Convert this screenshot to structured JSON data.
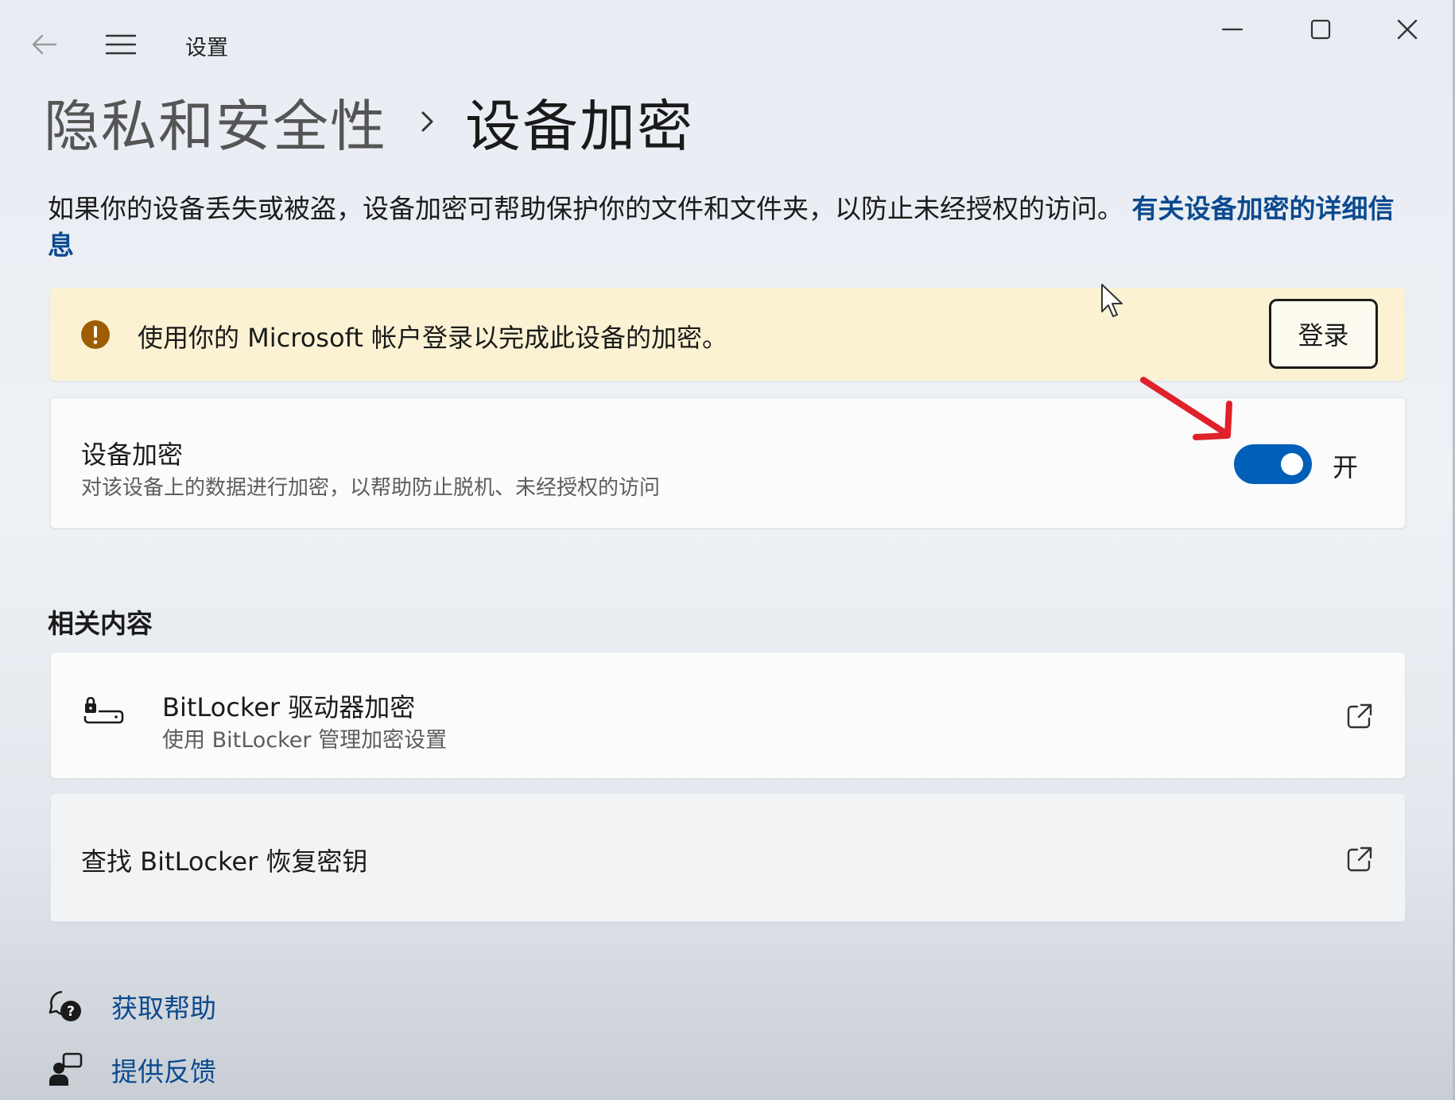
{
  "window": {
    "title": "设置"
  },
  "breadcrumb": {
    "parent": "隐私和安全性",
    "current": "设备加密"
  },
  "description": {
    "text": "如果你的设备丢失或被盗，设备加密可帮助保护你的文件和文件夹，以防止未经授权的访问。",
    "link": "有关设备加密的详细信息"
  },
  "warning": {
    "text": "使用你的 Microsoft 帐户登录以完成此设备的加密。",
    "button": "登录",
    "color": "#fbf2d3",
    "icon_color": "#9d5d00"
  },
  "encryption": {
    "title": "设备加密",
    "subtitle": "对该设备上的数据进行加密，以帮助防止脱机、未经授权的访问",
    "toggle_state": "开",
    "toggle_on": true,
    "accent": "#005fb8"
  },
  "related": {
    "header": "相关内容",
    "items": [
      {
        "title": "BitLocker 驱动器加密",
        "subtitle": "使用 BitLocker 管理加密设置"
      },
      {
        "title": "查找 BitLocker 恢复密钥"
      }
    ]
  },
  "footer": {
    "help": "获取帮助",
    "feedback": "提供反馈",
    "link_color": "#0b4a8f"
  },
  "icons": [
    "back-arrow-icon",
    "hamburger-menu-icon",
    "minimize-icon",
    "maximize-icon",
    "close-icon",
    "chevron-right-icon",
    "warning-icon",
    "bitlocker-drive-icon",
    "external-link-icon",
    "help-icon",
    "feedback-icon",
    "cursor-icon"
  ]
}
